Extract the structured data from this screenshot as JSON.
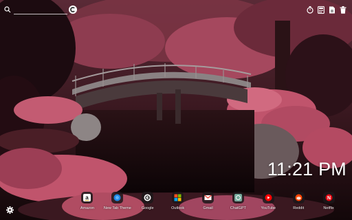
{
  "search": {
    "placeholder": "",
    "value": ""
  },
  "top_icons": [
    "timer-icon",
    "calculator-icon",
    "notes-icon",
    "trash-icon"
  ],
  "clock": {
    "time": "11:21 PM"
  },
  "shortcuts": [
    {
      "label": "Amazon",
      "icon": "amazon-icon",
      "color": "#ffffff"
    },
    {
      "label": "New Tab Theme",
      "icon": "new-tab-theme-icon",
      "color": "#1e88e5"
    },
    {
      "label": "Google",
      "icon": "google-icon",
      "color": "#ffffff"
    },
    {
      "label": "Outlook",
      "icon": "outlook-icon",
      "color": "#f25022"
    },
    {
      "label": "Gmail",
      "icon": "gmail-icon",
      "color": "#ea4335"
    },
    {
      "label": "ChatGPT",
      "icon": "chatgpt-icon",
      "color": "#74aa9c"
    },
    {
      "label": "YouTube",
      "icon": "youtube-icon",
      "color": "#ff0000"
    },
    {
      "label": "Reddit",
      "icon": "reddit-icon",
      "color": "#ff4500"
    },
    {
      "label": "Netflix",
      "icon": "netflix-icon",
      "color": "#e50914"
    }
  ],
  "colors": {
    "accent": "#ffffff",
    "foliage": "#c0546c",
    "dock_tile": "#1c181a"
  }
}
